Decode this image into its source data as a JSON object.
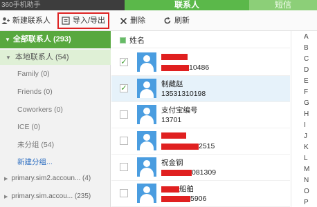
{
  "app": {
    "title": "360手机助手"
  },
  "tabs": {
    "contacts": "联系人",
    "sms": "短信"
  },
  "toolbar": {
    "new_contact": "新建联系人",
    "import_export": "导入/导出",
    "delete": "删除",
    "refresh": "刷新"
  },
  "sidebar": {
    "all_contacts": "全部联系人 (293)",
    "local_contacts": "本地联系人 (54)",
    "groups": [
      "Family (0)",
      "Friends (0)",
      "Coworkers (0)",
      "ICE (0)",
      "未分组 (54)"
    ],
    "new_group": "新建分组...",
    "accounts": [
      "primary.sim2.accoun... (4)",
      "primary.sim.accou... (235)"
    ]
  },
  "list": {
    "header": "姓名",
    "contacts": [
      {
        "name": "",
        "phone": "10486",
        "checked": true
      },
      {
        "name": "制藏赵",
        "phone": "13531310198",
        "checked": true
      },
      {
        "name": "支付宝编号",
        "phone": "13701",
        "checked": false
      },
      {
        "name": "",
        "phone": "2515",
        "checked": false
      },
      {
        "name": "祝金钢",
        "phone": "081309",
        "checked": false
      },
      {
        "name": "船舶",
        "phone": "5906",
        "checked": false
      }
    ]
  },
  "alphabet": [
    "A",
    "B",
    "C",
    "D",
    "E",
    "F",
    "G",
    "H",
    "I",
    "J",
    "K",
    "L",
    "M",
    "N",
    "O",
    "P"
  ],
  "colors": {
    "accent_green": "#58a83f",
    "tab_green": "#5bb84a",
    "highlight_red": "#d22222",
    "avatar_blue": "#4a9de0"
  }
}
